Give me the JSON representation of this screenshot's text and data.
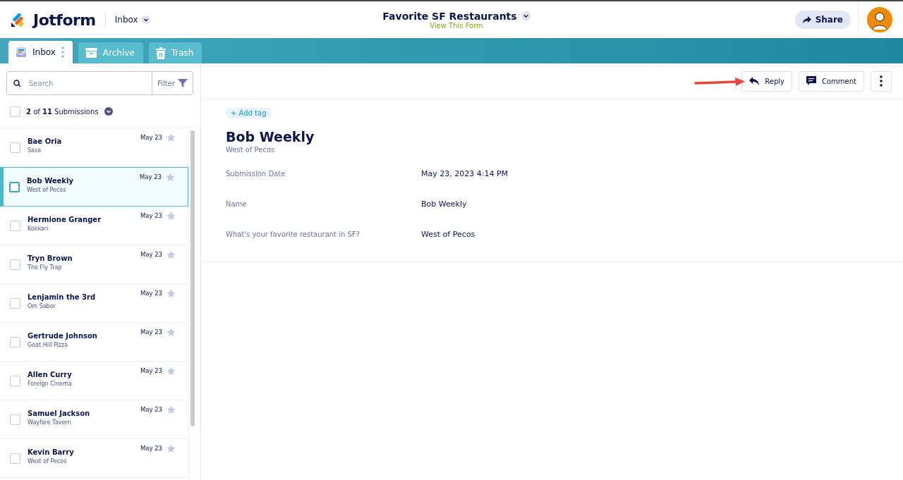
{
  "header": {
    "brand": "Jotform",
    "menu": "Inbox",
    "form_title": "Favorite SF Restaurants",
    "form_link": "View This Form",
    "share": "Share"
  },
  "tabs": [
    {
      "label": "Inbox",
      "kind": "inbox",
      "selected": true
    },
    {
      "label": "Archive",
      "kind": "archive",
      "selected": false
    },
    {
      "label": "Trash",
      "kind": "trash",
      "selected": false
    }
  ],
  "search": {
    "placeholder": "Search",
    "filter": "Filter"
  },
  "list_header": {
    "checked": false,
    "count": "**2** of **11** Submissions"
  },
  "submissions": [
    {
      "name": "Bae Oria",
      "restaurant": "Sasa",
      "date": "May 23",
      "starred": false,
      "checked": false,
      "selected": false
    },
    {
      "name": "Bob Weekly",
      "restaurant": "West of Pecos",
      "date": "May 23",
      "starred": false,
      "checked": false,
      "selected": true
    },
    {
      "name": "Hermione Granger",
      "restaurant": "Kokkari",
      "date": "May 23",
      "starred": false,
      "checked": false,
      "selected": false
    },
    {
      "name": "Tryn Brown",
      "restaurant": "The Fly Trap",
      "date": "May 23",
      "starred": false,
      "checked": false,
      "selected": false
    },
    {
      "name": "Lenjamin the 3rd",
      "restaurant": "Om Sabor",
      "date": "May 23",
      "starred": false,
      "checked": false,
      "selected": false
    },
    {
      "name": "Gertrude Johnson",
      "restaurant": "Goat Hill Pizza",
      "date": "May 23",
      "starred": false,
      "checked": false,
      "selected": false
    },
    {
      "name": "Allen Curry",
      "restaurant": "Foreign Cinema",
      "date": "May 23",
      "starred": false,
      "checked": false,
      "selected": false
    },
    {
      "name": "Samuel Jackson",
      "restaurant": "Wayfare Tavern",
      "date": "May 23",
      "starred": false,
      "checked": false,
      "selected": false
    },
    {
      "name": "Kevin Barry",
      "restaurant": "West of Pecos",
      "date": "May 23",
      "starred": false,
      "checked": false,
      "selected": false
    }
  ],
  "toolbar": {
    "reply": "Reply",
    "comment": "Comment"
  },
  "detail": {
    "add_tag": "+ Add tag",
    "title": "Bob Weekly",
    "subtitle": "West of Pecos",
    "fields": [
      {
        "label": "Submission Date",
        "value": "May 23, 2023 4:14 PM"
      },
      {
        "label": "Name",
        "value": "Bob Weekly"
      },
      {
        "label": "What's your favorite restaurant in SF?",
        "value": "West of Pecos"
      }
    ]
  }
}
